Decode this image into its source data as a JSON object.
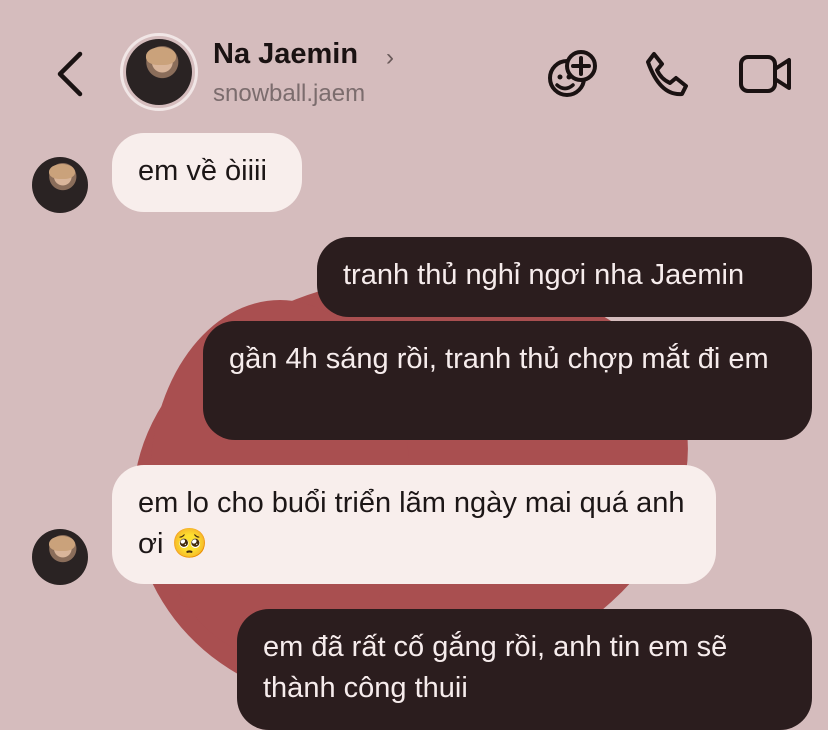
{
  "header": {
    "name": "Na Jaemin",
    "username": "snowball.jaem",
    "chevron": "›",
    "icons": [
      "back-icon",
      "add-effect-icon",
      "phone-icon",
      "video-icon"
    ]
  },
  "colors": {
    "background": "#d5bcbd",
    "accent_blob": "#a94f50",
    "incoming_bubble": "#f8eeec",
    "outgoing_bubble": "#2b1d1e"
  },
  "messages": [
    {
      "from": "them",
      "text": "em về òiiii"
    },
    {
      "from": "me",
      "text": "tranh thủ nghỉ ngơi nha Jaemin"
    },
    {
      "from": "me",
      "text": "gần 4h sáng rồi, tranh thủ chợp mắt đi em"
    },
    {
      "from": "them",
      "text": "em lo cho buổi triển lãm ngày mai quá anh ơi 🥺"
    },
    {
      "from": "me",
      "text": "em đã rất cố gắng rồi, anh tin em sẽ thành công thuii"
    }
  ]
}
